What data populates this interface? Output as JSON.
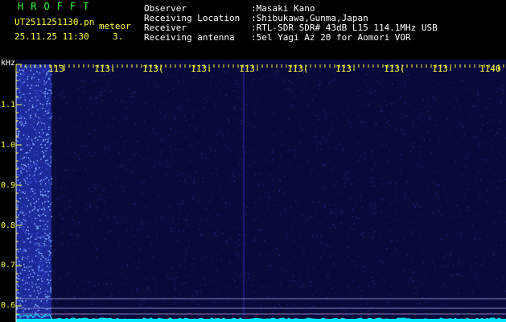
{
  "header": {
    "brand": "HROFFT",
    "filename": "UT2511251130.pn",
    "meteor_label": "meteor",
    "datetime": "25.11.25 11:30",
    "count": "3."
  },
  "metadata": [
    {
      "key": "Observer",
      "value": ":Masaki Kano"
    },
    {
      "key": "Receiving Location",
      "value": ":Shibukawa,Gunma,Japan"
    },
    {
      "key": "Receiver",
      "value": ":RTL-SDR SDR# 43dB L15 114.1MHz USB"
    },
    {
      "key": "Receiving antenna",
      "value": ":5el Yagi Az 20 for Aomori VOR"
    }
  ],
  "spectrogram": {
    "y_unit": "kHz",
    "y_ticks": [
      "1.1",
      "1.0",
      "0.9",
      "0.8",
      "0.7",
      "0.6"
    ],
    "x_ticks": [
      "113",
      "113:",
      "113(",
      "113:",
      "113",
      "113(",
      "113",
      "113(",
      "113",
      "1140"
    ],
    "colors": {
      "background": "#0a0a3a",
      "noise": "#2a2aa8",
      "bright": "#7fb0ff",
      "trace": "#00e5ff",
      "tick": "#ffff33"
    }
  }
}
